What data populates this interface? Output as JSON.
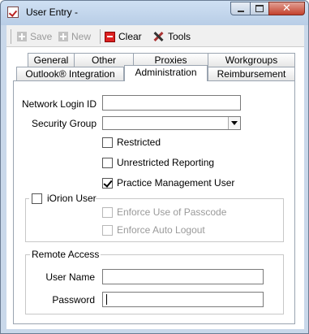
{
  "window": {
    "title": "User Entry -"
  },
  "toolbar": {
    "save_label": "Save",
    "new_label": "New",
    "clear_label": "Clear",
    "tools_label": "Tools"
  },
  "tabs": {
    "row1": [
      "General",
      "Other",
      "Proxies",
      "Workgroups"
    ],
    "row2": [
      "Outlook® Integration",
      "Administration",
      "Reimbursement"
    ],
    "active": "Administration"
  },
  "form": {
    "network_login_label": "Network Login ID",
    "network_login_value": "",
    "security_group_label": "Security Group",
    "security_group_value": "",
    "checkboxes": [
      {
        "label": "Restricted",
        "checked": false
      },
      {
        "label": "Unrestricted Reporting",
        "checked": false
      },
      {
        "label": "Practice Management User",
        "checked": true
      }
    ],
    "iorion": {
      "label": "iOrion User",
      "checked": false,
      "options": [
        {
          "label": "Enforce Use of Passcode",
          "checked": false,
          "enabled": false
        },
        {
          "label": "Enforce Auto Logout",
          "checked": false,
          "enabled": false
        }
      ]
    },
    "remote_access": {
      "title": "Remote Access",
      "user_name_label": "User Name",
      "user_name_value": "",
      "password_label": "Password",
      "password_value": ""
    }
  }
}
